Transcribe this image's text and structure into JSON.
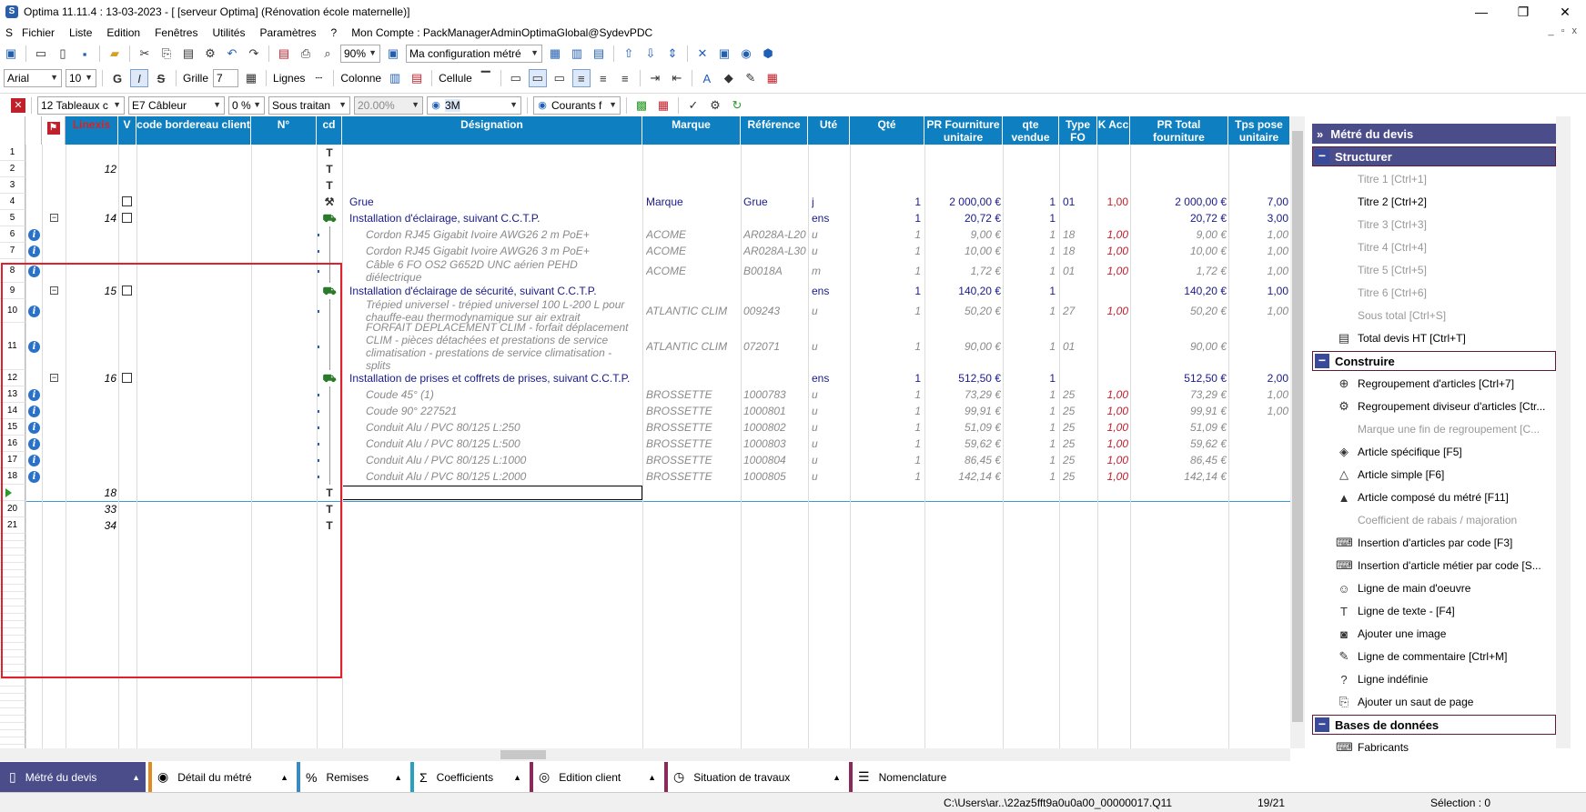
{
  "window": {
    "title": "Optima 11.11.4 : 13-03-2023 - [ [serveur Optima] (Rénovation école maternelle)]",
    "controls": [
      "—",
      "❐",
      "✕"
    ]
  },
  "menu": [
    "Fichier",
    "Liste",
    "Edition",
    "Fenêtres",
    "Utilités",
    "Paramètres",
    "?",
    "Mon Compte : PackManagerAdminOptimaGlobal@SydevPDC"
  ],
  "toolbar1": {
    "zoom": "90%",
    "config": "Ma configuration métré"
  },
  "toolbar2": {
    "font": "Arial",
    "size": "10",
    "bold": "G",
    "italic": "I",
    "strike": "S",
    "grille": "Grille",
    "grille_val": "7",
    "lignes": "Lignes",
    "colonne": "Colonne",
    "cellule": "Cellule"
  },
  "toolbar3": {
    "tableaux": "12  Tableaux c",
    "cableur": "E7  Câbleur",
    "pct": "0 %",
    "sous": "Sous traitan",
    "rate": "20.00%",
    "m3": "3M",
    "courants": "Courants f"
  },
  "grid": {
    "headers": [
      "Linexis",
      "V",
      "code bordereau client",
      "N°",
      "cd",
      "Désignation",
      "Marque",
      "Référence",
      "Uté",
      "Qté",
      "PR Fourniture unitaire",
      "qte vendue",
      "Type FO",
      "K Acc",
      "PR Total fourniture",
      "Tps pose unitaire"
    ],
    "rows": [
      {
        "n": "1",
        "lx": "",
        "des": "",
        "mq": "",
        "ref": "",
        "ute": "",
        "qte": "",
        "pru": "",
        "qv": "",
        "fo": "",
        "k": "",
        "prt": "",
        "tps": "",
        "kind": "blank"
      },
      {
        "n": "2",
        "lx": "12",
        "des": "",
        "mq": "",
        "ref": "",
        "ute": "",
        "qte": "",
        "pru": "",
        "qv": "",
        "fo": "",
        "k": "",
        "prt": "",
        "tps": "",
        "kind": "blank"
      },
      {
        "n": "3",
        "lx": "",
        "des": "",
        "mq": "",
        "ref": "",
        "ute": "",
        "qte": "",
        "pru": "",
        "qv": "",
        "fo": "",
        "k": "",
        "prt": "",
        "tps": "",
        "kind": "blank"
      },
      {
        "n": "4",
        "lx": "",
        "des": "Grue",
        "mq": "Marque",
        "ref": "Grue",
        "ute": "j",
        "qte": "1",
        "pru": "2 000,00 €",
        "qv": "1",
        "fo": "01",
        "k": "1,00",
        "prt": "2 000,00 €",
        "tps": "7,00",
        "kind": "blue"
      },
      {
        "n": "5",
        "lx": "14",
        "des": "Installation d'éclairage, suivant C.C.T.P.",
        "mq": "",
        "ref": "",
        "ute": "ens",
        "qte": "1",
        "pru": "20,72 €",
        "qv": "1",
        "fo": "",
        "k": "",
        "prt": "20,72 €",
        "tps": "3,00",
        "kind": "blue"
      },
      {
        "n": "6",
        "lx": "",
        "des": "Cordon RJ45 Gigabit Ivoire AWG26 2 m PoE+",
        "mq": "ACOME",
        "ref": "AR028A-L20",
        "ute": "u",
        "qte": "1",
        "pru": "9,00 €",
        "qv": "1",
        "fo": "18",
        "k": "1,00",
        "prt": "9,00 €",
        "tps": "1,00",
        "kind": "gray"
      },
      {
        "n": "7",
        "lx": "",
        "des": "Cordon RJ45 Gigabit Ivoire AWG26 3 m PoE+",
        "mq": "ACOME",
        "ref": "AR028A-L30",
        "ute": "u",
        "qte": "1",
        "pru": "10,00 €",
        "qv": "1",
        "fo": "18",
        "k": "1,00",
        "prt": "10,00 €",
        "tps": "1,00",
        "kind": "gray"
      },
      {
        "n": "8",
        "lx": "",
        "des": "Câble 6 FO OS2 G652D UNC aérien PEHD",
        "des2": "diélectrique",
        "mq": "ACOME",
        "ref": "B0018A",
        "ute": "m",
        "qte": "1",
        "pru": "1,72 €",
        "qv": "1",
        "fo": "01",
        "k": "1,00",
        "prt": "1,72 €",
        "tps": "1,00",
        "kind": "gray"
      },
      {
        "n": "9",
        "lx": "15",
        "des": "Installation d'éclairage de sécurité, suivant C.C.T.P.",
        "mq": "",
        "ref": "",
        "ute": "ens",
        "qte": "1",
        "pru": "140,20 €",
        "qv": "1",
        "fo": "",
        "k": "",
        "prt": "140,20 €",
        "tps": "1,00",
        "kind": "blue"
      },
      {
        "n": "10",
        "lx": "",
        "des": "Trépied universel - trépied universel 100 L-200 L pour",
        "des2": "chauffe-eau thermodynamique sur air extrait",
        "mq": "ATLANTIC CLIM",
        "ref": "009243",
        "ute": "u",
        "qte": "1",
        "pru": "50,20 €",
        "qv": "1",
        "fo": "27",
        "k": "1,00",
        "prt": "50,20 €",
        "tps": "1,00",
        "kind": "gray"
      },
      {
        "n": "11",
        "lx": "",
        "des": "FORFAIT DEPLACEMENT CLIM - forfait déplacement",
        "des2": "CLIM - pièces détachées et prestations de service",
        "des3": "climatisation - prestations de service climatisation -",
        "des4": "splits",
        "mq": "ATLANTIC CLIM",
        "ref": "072071",
        "ute": "u",
        "qte": "1",
        "pru": "90,00 €",
        "qv": "1",
        "fo": "01",
        "k": "",
        "prt": "90,00 €",
        "tps": "",
        "kind": "gray"
      },
      {
        "n": "12",
        "lx": "16",
        "des": "Installation de prises et coffrets de prises, suivant C.C.T.P.",
        "mq": "",
        "ref": "",
        "ute": "ens",
        "qte": "1",
        "pru": "512,50 €",
        "qv": "1",
        "fo": "",
        "k": "",
        "prt": "512,50 €",
        "tps": "2,00",
        "kind": "blue"
      },
      {
        "n": "13",
        "lx": "",
        "des": "Coude 45° (1)",
        "mq": "BROSSETTE",
        "ref": "1000783",
        "ute": "u",
        "qte": "1",
        "pru": "73,29 €",
        "qv": "1",
        "fo": "25",
        "k": "1,00",
        "prt": "73,29 €",
        "tps": "1,00",
        "kind": "gray"
      },
      {
        "n": "14",
        "lx": "",
        "des": "Coude 90° 227521",
        "mq": "BROSSETTE",
        "ref": "1000801",
        "ute": "u",
        "qte": "1",
        "pru": "99,91 €",
        "qv": "1",
        "fo": "25",
        "k": "1,00",
        "prt": "99,91 €",
        "tps": "1,00",
        "kind": "gray"
      },
      {
        "n": "15",
        "lx": "",
        "des": "Conduit Alu / PVC 80/125 L:250",
        "mq": "BROSSETTE",
        "ref": "1000802",
        "ute": "u",
        "qte": "1",
        "pru": "51,09 €",
        "qv": "1",
        "fo": "25",
        "k": "1,00",
        "prt": "51,09 €",
        "tps": "",
        "kind": "gray"
      },
      {
        "n": "16",
        "lx": "",
        "des": "Conduit Alu / PVC 80/125 L:500",
        "mq": "BROSSETTE",
        "ref": "1000803",
        "ute": "u",
        "qte": "1",
        "pru": "59,62 €",
        "qv": "1",
        "fo": "25",
        "k": "1,00",
        "prt": "59,62 €",
        "tps": "",
        "kind": "gray"
      },
      {
        "n": "17",
        "lx": "",
        "des": "Conduit Alu / PVC 80/125 L:1000",
        "mq": "BROSSETTE",
        "ref": "1000804",
        "ute": "u",
        "qte": "1",
        "pru": "86,45 €",
        "qv": "1",
        "fo": "25",
        "k": "1,00",
        "prt": "86,45 €",
        "tps": "",
        "kind": "gray"
      },
      {
        "n": "18",
        "lx": "",
        "des": "Conduit Alu / PVC 80/125 L:2000",
        "mq": "BROSSETTE",
        "ref": "1000805",
        "ute": "u",
        "qte": "1",
        "pru": "142,14 €",
        "qv": "1",
        "fo": "25",
        "k": "1,00",
        "prt": "142,14 €",
        "tps": "",
        "kind": "gray"
      },
      {
        "n": "",
        "lx": "18",
        "des": "",
        "mq": "",
        "ref": "",
        "ute": "",
        "qte": "",
        "pru": "",
        "qv": "",
        "fo": "",
        "k": "",
        "prt": "",
        "tps": "",
        "kind": "current"
      },
      {
        "n": "20",
        "lx": "33",
        "des": "",
        "mq": "",
        "ref": "",
        "ute": "",
        "qte": "",
        "pru": "",
        "qv": "",
        "fo": "",
        "k": "",
        "prt": "",
        "tps": "",
        "kind": "blank"
      },
      {
        "n": "21",
        "lx": "34",
        "des": "",
        "mq": "",
        "ref": "",
        "ute": "",
        "qte": "",
        "pru": "",
        "qv": "",
        "fo": "",
        "k": "",
        "prt": "",
        "tps": "",
        "kind": "blank"
      }
    ]
  },
  "panel": {
    "title": "Métré du devis",
    "groups": [
      {
        "label": "Structurer",
        "items": [
          {
            "label": "Titre 1 [Ctrl+1]",
            "dis": true,
            "icon": ""
          },
          {
            "label": "Titre 2 [Ctrl+2]",
            "dis": false,
            "icon": ""
          },
          {
            "label": "Titre 3 [Ctrl+3]",
            "dis": true,
            "icon": ""
          },
          {
            "label": "Titre 4 [Ctrl+4]",
            "dis": true,
            "icon": ""
          },
          {
            "label": "Titre 5 [Ctrl+5]",
            "dis": true,
            "icon": ""
          },
          {
            "label": "Titre 6 [Ctrl+6]",
            "dis": true,
            "icon": ""
          },
          {
            "label": "Sous total [Ctrl+S]",
            "dis": true,
            "icon": ""
          },
          {
            "label": "Total devis HT [Ctrl+T]",
            "dis": false,
            "icon": "▤"
          }
        ]
      },
      {
        "label": "Construire",
        "items": [
          {
            "label": "Regroupement d'articles  [Ctrl+7]",
            "dis": false,
            "icon": "⊕"
          },
          {
            "label": "Regroupement diviseur d'articles [Ctr...",
            "dis": false,
            "icon": "⚙"
          },
          {
            "label": "Marque une fin de regroupement  [C...",
            "dis": true,
            "icon": ""
          },
          {
            "label": "Article spécifique [F5]",
            "dis": false,
            "icon": "◈"
          },
          {
            "label": "Article simple [F6]",
            "dis": false,
            "icon": "△"
          },
          {
            "label": "Article composé du métré [F11]",
            "dis": false,
            "icon": "▲"
          },
          {
            "label": "Coefficient de rabais / majoration",
            "dis": true,
            "icon": ""
          },
          {
            "label": "Insertion d'articles par code [F3]",
            "dis": false,
            "icon": "⌨"
          },
          {
            "label": "Insertion d'article métier par code [S...",
            "dis": false,
            "icon": "⌨"
          },
          {
            "label": "Ligne de main d'oeuvre",
            "dis": false,
            "icon": "☺"
          },
          {
            "label": "Ligne de texte - [F4]",
            "dis": false,
            "icon": "T"
          },
          {
            "label": "Ajouter une image",
            "dis": false,
            "icon": "◙"
          },
          {
            "label": "Ligne de commentaire [Ctrl+M]",
            "dis": false,
            "icon": "✎"
          },
          {
            "label": "Ligne indéfinie",
            "dis": false,
            "icon": "?"
          },
          {
            "label": "Ajouter un saut de page",
            "dis": false,
            "icon": "⎘"
          }
        ]
      },
      {
        "label": "Bases de données",
        "items": [
          {
            "label": "Fabricants",
            "dis": false,
            "icon": "⌨"
          }
        ]
      }
    ]
  },
  "tabs": [
    {
      "label": "Métré du devis",
      "icon": "▯",
      "color": "#4a4d8a",
      "active": true
    },
    {
      "label": "Détail du métré",
      "icon": "◉",
      "color": "#e08a20",
      "active": false
    },
    {
      "label": "Remises",
      "icon": "%",
      "color": "#3a8ac0",
      "active": false
    },
    {
      "label": "Coefficients",
      "icon": "Σ",
      "color": "#2aa0c0",
      "active": false
    },
    {
      "label": "Edition client",
      "icon": "◎",
      "color": "#8a2a5a",
      "active": false
    },
    {
      "label": "Situation de travaux",
      "icon": "◷",
      "color": "#8a2a5a",
      "active": false
    },
    {
      "label": "Nomenclature",
      "icon": "☰",
      "color": "#8a2a5a",
      "active": false
    }
  ],
  "status": {
    "path": "C:\\Users\\ar..\\22az5fft9a0u0a00_00000017.Q11",
    "pos": "19/21",
    "sel": "Sélection : 0"
  }
}
